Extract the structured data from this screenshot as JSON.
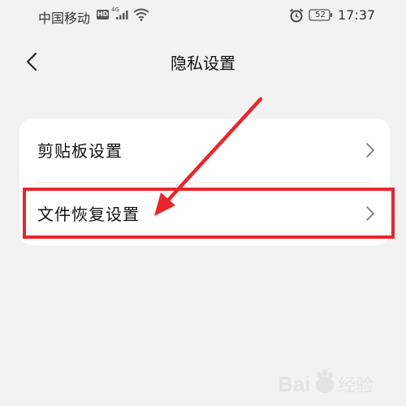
{
  "status_bar": {
    "carrier": "中国移动",
    "hd": "HD",
    "network": "4G",
    "battery": "52",
    "time": "17:37"
  },
  "nav": {
    "title": "隐私设置",
    "back_icon": "chevron-left-icon"
  },
  "settings": {
    "items": [
      {
        "label": "剪贴板设置",
        "icon": "chevron-right-icon"
      },
      {
        "label": "文件恢复设置",
        "icon": "chevron-right-icon"
      }
    ]
  },
  "annotation": {
    "color": "#e8262c",
    "highlighted_item": "文件恢复设置"
  },
  "watermark": {
    "text": "Baidu经验"
  }
}
